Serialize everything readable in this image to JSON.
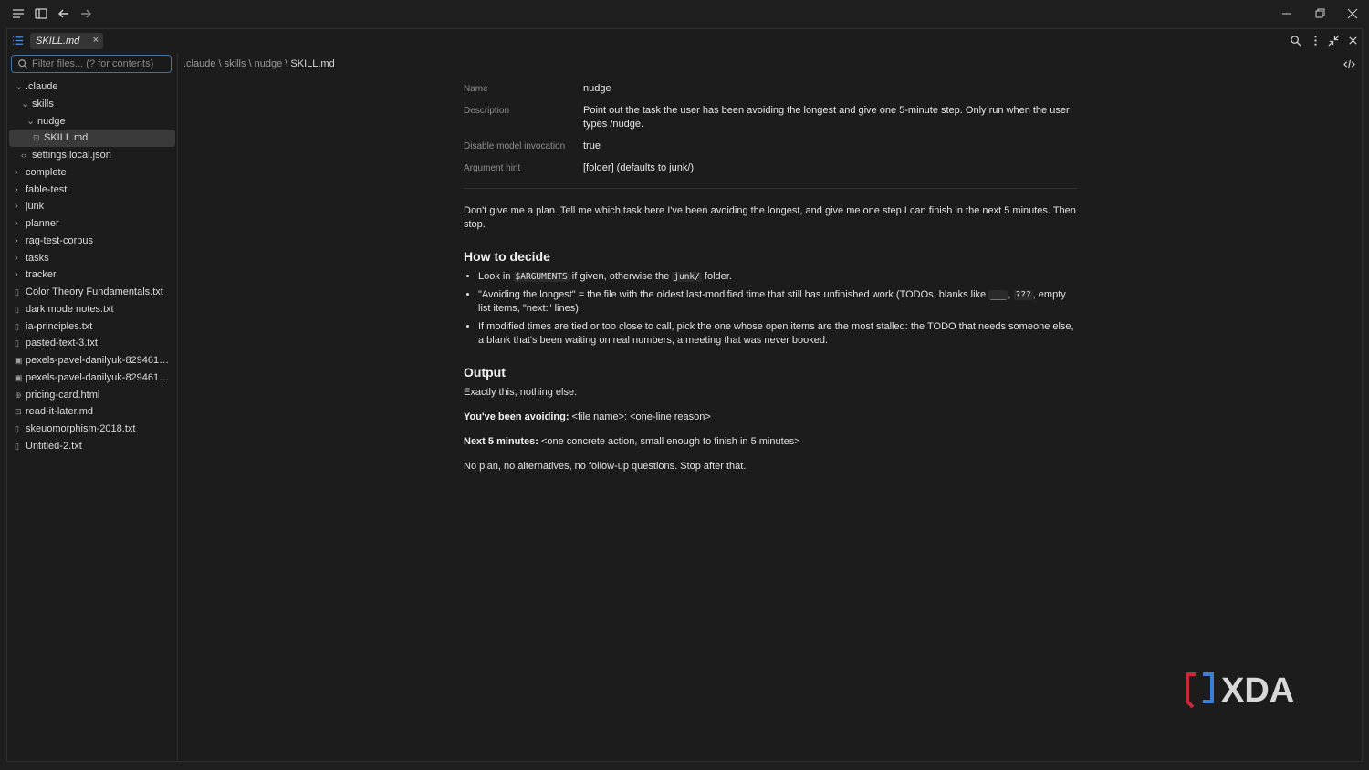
{
  "tab": {
    "title": "SKILL.md",
    "close": "×"
  },
  "sidebar": {
    "filter_placeholder": "Filter files... (? for contents)",
    "tree": [
      {
        "label": ".claude",
        "level": 0,
        "kind": "folder-open"
      },
      {
        "label": "skills",
        "level": 1,
        "kind": "folder-open"
      },
      {
        "label": "nudge",
        "level": 2,
        "kind": "folder-open"
      },
      {
        "label": "SKILL.md",
        "level": 3,
        "kind": "file-md",
        "selected": true
      },
      {
        "label": "settings.local.json",
        "level": 1,
        "kind": "file-json"
      },
      {
        "label": "complete",
        "level": 0,
        "kind": "folder"
      },
      {
        "label": "fable-test",
        "level": 0,
        "kind": "folder"
      },
      {
        "label": "junk",
        "level": 0,
        "kind": "folder"
      },
      {
        "label": "planner",
        "level": 0,
        "kind": "folder"
      },
      {
        "label": "rag-test-corpus",
        "level": 0,
        "kind": "folder"
      },
      {
        "label": "tasks",
        "level": 0,
        "kind": "folder"
      },
      {
        "label": "tracker",
        "level": 0,
        "kind": "folder"
      },
      {
        "label": "Color Theory Fundamentals.txt",
        "level": 0,
        "kind": "file"
      },
      {
        "label": "dark mode notes.txt",
        "level": 0,
        "kind": "file"
      },
      {
        "label": "ia-principles.txt",
        "level": 0,
        "kind": "file"
      },
      {
        "label": "pasted-text-3.txt",
        "level": 0,
        "kind": "file"
      },
      {
        "label": "pexels-pavel-danilyuk-8294615...",
        "level": 0,
        "kind": "file-image"
      },
      {
        "label": "pexels-pavel-danilyuk-8294615...",
        "level": 0,
        "kind": "file-image"
      },
      {
        "label": "pricing-card.html",
        "level": 0,
        "kind": "file-html"
      },
      {
        "label": "read-it-later.md",
        "level": 0,
        "kind": "file-md"
      },
      {
        "label": "skeuomorphism-2018.txt",
        "level": 0,
        "kind": "file"
      },
      {
        "label": "Untitled-2.txt",
        "level": 0,
        "kind": "file"
      }
    ]
  },
  "breadcrumb": {
    "path": ".claude \\ skills \\ nudge \\ ",
    "current": "SKILL.md"
  },
  "frontmatter": {
    "name_key": "Name",
    "name_val": "nudge",
    "desc_key": "Description",
    "desc_val": "Point out the task the user has been avoiding the longest and give one 5-minute step. Only run when the user types /nudge.",
    "dmi_key": "Disable model invocation",
    "dmi_val": "true",
    "arg_key": "Argument hint",
    "arg_val": "[folder] (defaults to junk/)"
  },
  "body": {
    "intro": "Don't give me a plan. Tell me which task here I've been avoiding the longest, and give me one step I can finish in the next 5 minutes. Then stop.",
    "h_decide": "How to decide",
    "b1_a": "Look in ",
    "b1_code1": "$ARGUMENTS",
    "b1_b": " if given, otherwise the ",
    "b1_code2": "junk/",
    "b1_c": " folder.",
    "b2_a": "\"Avoiding the longest\" = the file with the oldest last-modified time that still has unfinished work (TODOs, blanks like ",
    "b2_code1": "___",
    "b2_b": ", ",
    "b2_code2": "???",
    "b2_c": ", empty list items, \"next:\" lines).",
    "b3": "If modified times are tied or too close to call, pick the one whose open items are the most stalled: the TODO that needs someone else, a blank that's been waiting on real numbers, a meeting that was never booked.",
    "h_output": "Output",
    "out_intro": "Exactly this, nothing else:",
    "out1_bold": "You've been avoiding:",
    "out1_rest": " <file name>: <one-line reason>",
    "out2_bold": "Next 5 minutes:",
    "out2_rest": " <one concrete action, small enough to finish in 5 minutes>",
    "out_end": "No plan, no alternatives, no follow-up questions. Stop after that."
  },
  "watermark": {
    "text": "XDA"
  },
  "colors": {
    "accent": "#4a6fa5",
    "logo_red": "#c8283c",
    "logo_blue": "#3b7fd4"
  }
}
